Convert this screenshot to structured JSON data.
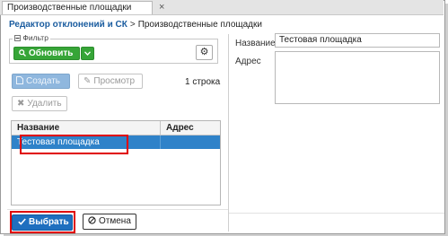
{
  "tab": {
    "title": "Производственные площадки",
    "close_glyph": "×"
  },
  "breadcrumb": {
    "parent": "Редактор отклонений и СК",
    "separator": ">",
    "current": "Производственные площадки"
  },
  "filter": {
    "legend": "Фильтр",
    "legend_icon": "collapse-icon",
    "refresh_label": "Обновить",
    "refresh_icon": "search-icon",
    "dropdown_icon": "chevron-down-icon",
    "settings_icon": "gear-icon"
  },
  "toolbar": {
    "create_label": "Создать",
    "view_label": "Просмотр",
    "delete_label": "Удалить",
    "row_count": "1 строка"
  },
  "grid": {
    "columns": [
      "Название",
      "Адрес"
    ],
    "rows": [
      {
        "name": "Тестовая площадка",
        "address": ""
      }
    ]
  },
  "detail": {
    "name_label": "Название",
    "name_value": "Тестовая площадка",
    "address_label": "Адрес",
    "address_value": ""
  },
  "footer": {
    "select_label": "Выбрать",
    "cancel_label": "Отмена"
  },
  "colors": {
    "accent": "#1f6fbf",
    "selection": "#2f82c9",
    "refresh_green": "#36a537",
    "highlight_red": "#e00000"
  }
}
